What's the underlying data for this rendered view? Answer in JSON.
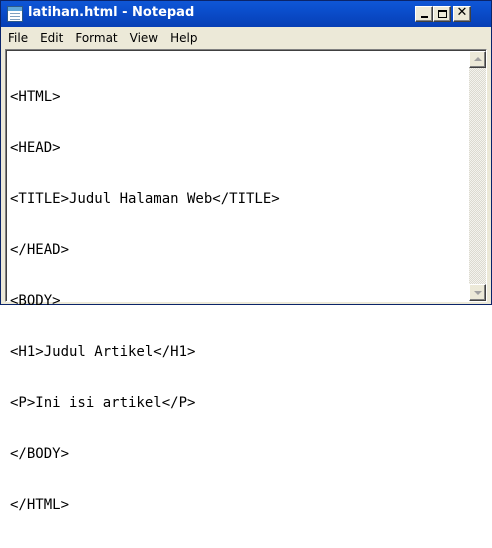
{
  "window": {
    "title": "latihan.html - Notepad",
    "controls": {
      "minimize_icon": "minimize-icon",
      "maximize_icon": "maximize-icon",
      "close_icon": "close-icon",
      "close_glyph": "✕"
    }
  },
  "menu": {
    "items": [
      "File",
      "Edit",
      "Format",
      "View",
      "Help"
    ]
  },
  "editor": {
    "lines": [
      "<HTML>",
      "<HEAD>",
      "<TITLE>Judul Halaman Web</TITLE>",
      "</HEAD>",
      "<BODY>",
      "<H1>Judul Artikel</H1>",
      "<P>Ini isi artikel</P>",
      "</BODY>",
      "</HTML>"
    ]
  },
  "colors": {
    "titlebar": "#0a4dcb",
    "title_text": "#ffffff",
    "chrome": "#ece9d8",
    "editor_bg": "#ffffff"
  }
}
